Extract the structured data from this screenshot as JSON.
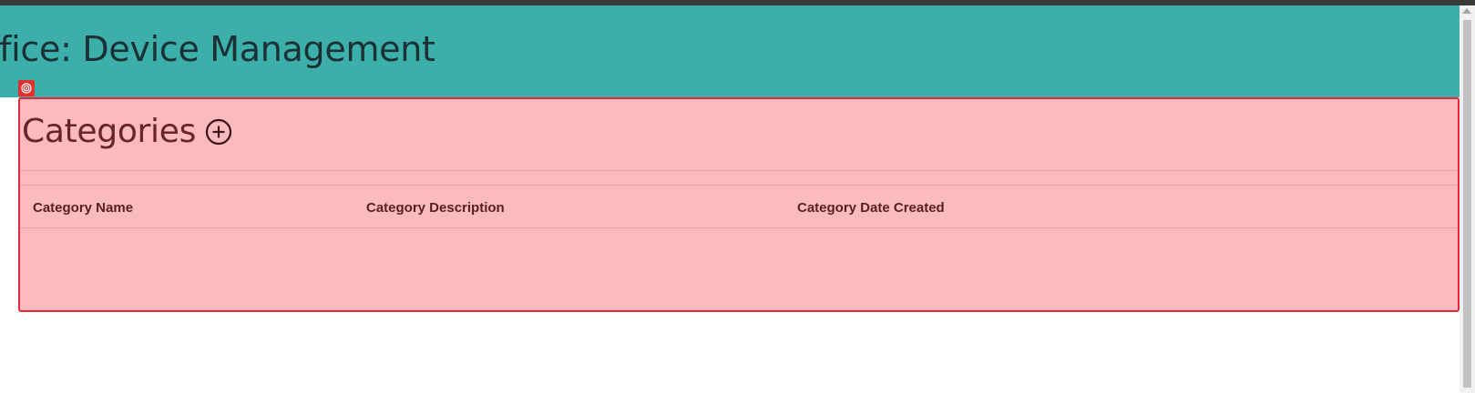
{
  "header": {
    "title": "ffice: Device Management",
    "background_color": "#3dafaa"
  },
  "debug_badge": {
    "icon": "target-icon",
    "color": "#e03131"
  },
  "categories_panel": {
    "title": "Categories",
    "add_icon": "plus-circle-icon",
    "background_color": "#fbbbbe",
    "border_color": "#e8263a",
    "table": {
      "columns": [
        "Category Name",
        "Category Description",
        "Category Date Created"
      ],
      "rows": []
    }
  },
  "scrollbar": {
    "present": true
  }
}
